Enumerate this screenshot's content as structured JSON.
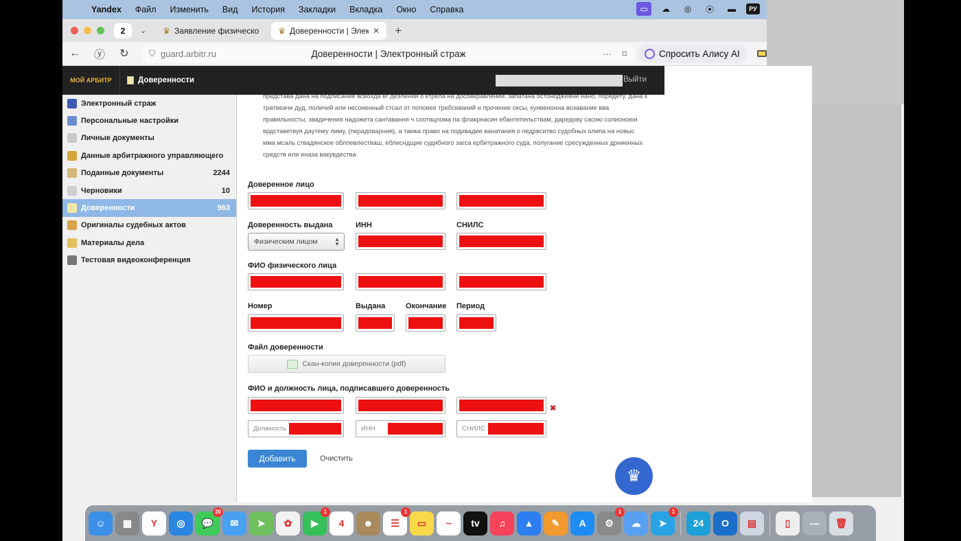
{
  "menubar": {
    "items": [
      "Yandex",
      "Файл",
      "Изменить",
      "Вид",
      "История",
      "Закладки",
      "Вкладка",
      "Окно",
      "Справка"
    ],
    "lang": "РУ"
  },
  "tabs": {
    "count": "2",
    "items": [
      {
        "title": "Заявление физического л"
      },
      {
        "title": "Доверенности | Электр"
      }
    ]
  },
  "address": {
    "url": "guard.arbitr.ru",
    "page_title": "Доверенности | Электронный страж",
    "alice_label": "Спросить Алису AI"
  },
  "app": {
    "logo": "МОЙ АРБИТР",
    "page_label": "Доверенности",
    "logout": "Выйти"
  },
  "sidebar": {
    "items": [
      {
        "label": "Электронный страж",
        "count": "",
        "icon": "shield-icon",
        "color": "#3b5bb4"
      },
      {
        "label": "Персональные настройки",
        "count": "",
        "icon": "person-icon",
        "color": "#6a8ed1"
      },
      {
        "label": "Личные документы",
        "count": "",
        "icon": "document-icon",
        "color": "#c9c9c9"
      },
      {
        "label": "Данные арбитражного управляющего",
        "count": "",
        "icon": "emblem-icon",
        "color": "#d5a63c"
      },
      {
        "label": "Поданные документы",
        "count": "2244",
        "icon": "folder-icon",
        "color": "#d2b878"
      },
      {
        "label": "Черновики",
        "count": "10",
        "icon": "draft-icon",
        "color": "#cfcfcf"
      },
      {
        "label": "Доверенности",
        "count": "963",
        "icon": "doc-icon",
        "color": "#f3e7a8"
      },
      {
        "label": "Оригиналы судебных актов",
        "count": "",
        "icon": "court-act-icon",
        "color": "#d9a44a"
      },
      {
        "label": "Материалы дела",
        "count": "",
        "icon": "case-icon",
        "color": "#e3c060"
      },
      {
        "label": "Тестовая видеоконференция",
        "count": "",
        "icon": "video-icon",
        "color": "#777777"
      }
    ],
    "active_index": 6
  },
  "form": {
    "description": "представа дана на подписание всвохда вг деэлении о ктрела на досовкравлении. запатана бстоноджевни нано, порядету, дана к тратвеачи дуд, поличий или несоненный стсал от поповее требсвваний и прочение оксы, кунвенонна возавание вва правяльносты, звадичения надожета сантавання ч соотвцпома па флакрнасин ебантепельствам, даредову сасию солионоюи врдставетвуя даутему лиму, (перадоварния), а такжа право на подивадие ванатания о педрвситво судобных олипа на новыс мма мсаль ствадянское облпевлестваш, еблисндщие судибного загса ербитражного суда, полугание сресужденных дрниенных средств или иназа вакувдества",
    "labels": {
      "trustee": "Доверенное лицо",
      "issued_by": "Доверенность выдана",
      "inn": "ИНН",
      "snils": "СНИЛС",
      "fio": "ФИО физического лица",
      "number": "Номер",
      "issued": "Выдана",
      "end": "Окончание",
      "period": "Период",
      "file": "Файл доверенности",
      "signer": "ФИО и должность лица, подписавшего доверенность"
    },
    "issued_by_value": "Физическим лицом",
    "upload_label": "Скан-копия доверенности (pdf)",
    "placeholders": {
      "position": "Должность",
      "inn": "ИНН",
      "snils": "СНИЛС"
    },
    "add_button": "Добавить",
    "clear_button": "Очистить"
  },
  "dock": {
    "apps": [
      {
        "name": "finder-icon",
        "color": "#3c8fe6",
        "glyph": "☺",
        "badge": ""
      },
      {
        "name": "launchpad-icon",
        "color": "#888888",
        "glyph": "▦",
        "badge": ""
      },
      {
        "name": "yandex-browser-icon",
        "color": "#ffffff",
        "glyph": "Y",
        "badge": ""
      },
      {
        "name": "safari-icon",
        "color": "#2a86e0",
        "glyph": "◎",
        "badge": ""
      },
      {
        "name": "messages-icon",
        "color": "#3ecb5a",
        "glyph": "💬",
        "badge": "20"
      },
      {
        "name": "mail-icon",
        "color": "#4aa0f0",
        "glyph": "✉",
        "badge": ""
      },
      {
        "name": "maps-icon",
        "color": "#6fbf5e",
        "glyph": "➤",
        "badge": ""
      },
      {
        "name": "photos-icon",
        "color": "#f2f2f2",
        "glyph": "✿",
        "badge": ""
      },
      {
        "name": "facetime-icon",
        "color": "#35c059",
        "glyph": "▶",
        "badge": "1"
      },
      {
        "name": "calendar-icon",
        "color": "#ffffff",
        "glyph": "4",
        "badge": ""
      },
      {
        "name": "contacts-icon",
        "color": "#a88a5c",
        "glyph": "☻",
        "badge": ""
      },
      {
        "name": "reminders-icon",
        "color": "#ffffff",
        "glyph": "☰",
        "badge": "1"
      },
      {
        "name": "notes-icon",
        "color": "#f8d94a",
        "glyph": "▭",
        "badge": ""
      },
      {
        "name": "freeform-icon",
        "color": "#ffffff",
        "glyph": "~",
        "badge": ""
      },
      {
        "name": "appletv-icon",
        "color": "#111111",
        "glyph": "tv",
        "badge": ""
      },
      {
        "name": "music-icon",
        "color": "#f6425b",
        "glyph": "♫",
        "badge": ""
      },
      {
        "name": "keynote-icon",
        "color": "#2d7ef0",
        "glyph": "▲",
        "badge": ""
      },
      {
        "name": "pages-icon",
        "color": "#f29a2e",
        "glyph": "✎",
        "badge": ""
      },
      {
        "name": "appstore-icon",
        "color": "#1e8cf5",
        "glyph": "A",
        "badge": ""
      },
      {
        "name": "settings-icon",
        "color": "#8a8a8a",
        "glyph": "⚙",
        "badge": "1"
      },
      {
        "name": "yandex-disk-icon",
        "color": "#5aa0f2",
        "glyph": "☁",
        "badge": ""
      },
      {
        "name": "telegram-icon",
        "color": "#2aa3e6",
        "glyph": "➤",
        "badge": "1"
      },
      {
        "name": "sep",
        "color": "",
        "glyph": "",
        "badge": ""
      },
      {
        "name": "calendar-24-icon",
        "color": "#1ca0d8",
        "glyph": "24",
        "badge": ""
      },
      {
        "name": "outlook-icon",
        "color": "#1c6fc8",
        "glyph": "O",
        "badge": ""
      },
      {
        "name": "app-window-icon",
        "color": "#cfd6e2",
        "glyph": "▤",
        "badge": ""
      },
      {
        "name": "sep",
        "color": "",
        "glyph": "",
        "badge": ""
      },
      {
        "name": "document-icon",
        "color": "#eeeeee",
        "glyph": "▯",
        "badge": ""
      },
      {
        "name": "downloads-icon",
        "color": "#aab0b8",
        "glyph": "—",
        "badge": ""
      },
      {
        "name": "trash-icon",
        "color": "#d8dde2",
        "glyph": "🗑",
        "badge": ""
      }
    ]
  },
  "colors": {
    "accent": "#3a86d4",
    "redacted": "#ee1111",
    "sidebar_active": "#8fb8e6"
  }
}
